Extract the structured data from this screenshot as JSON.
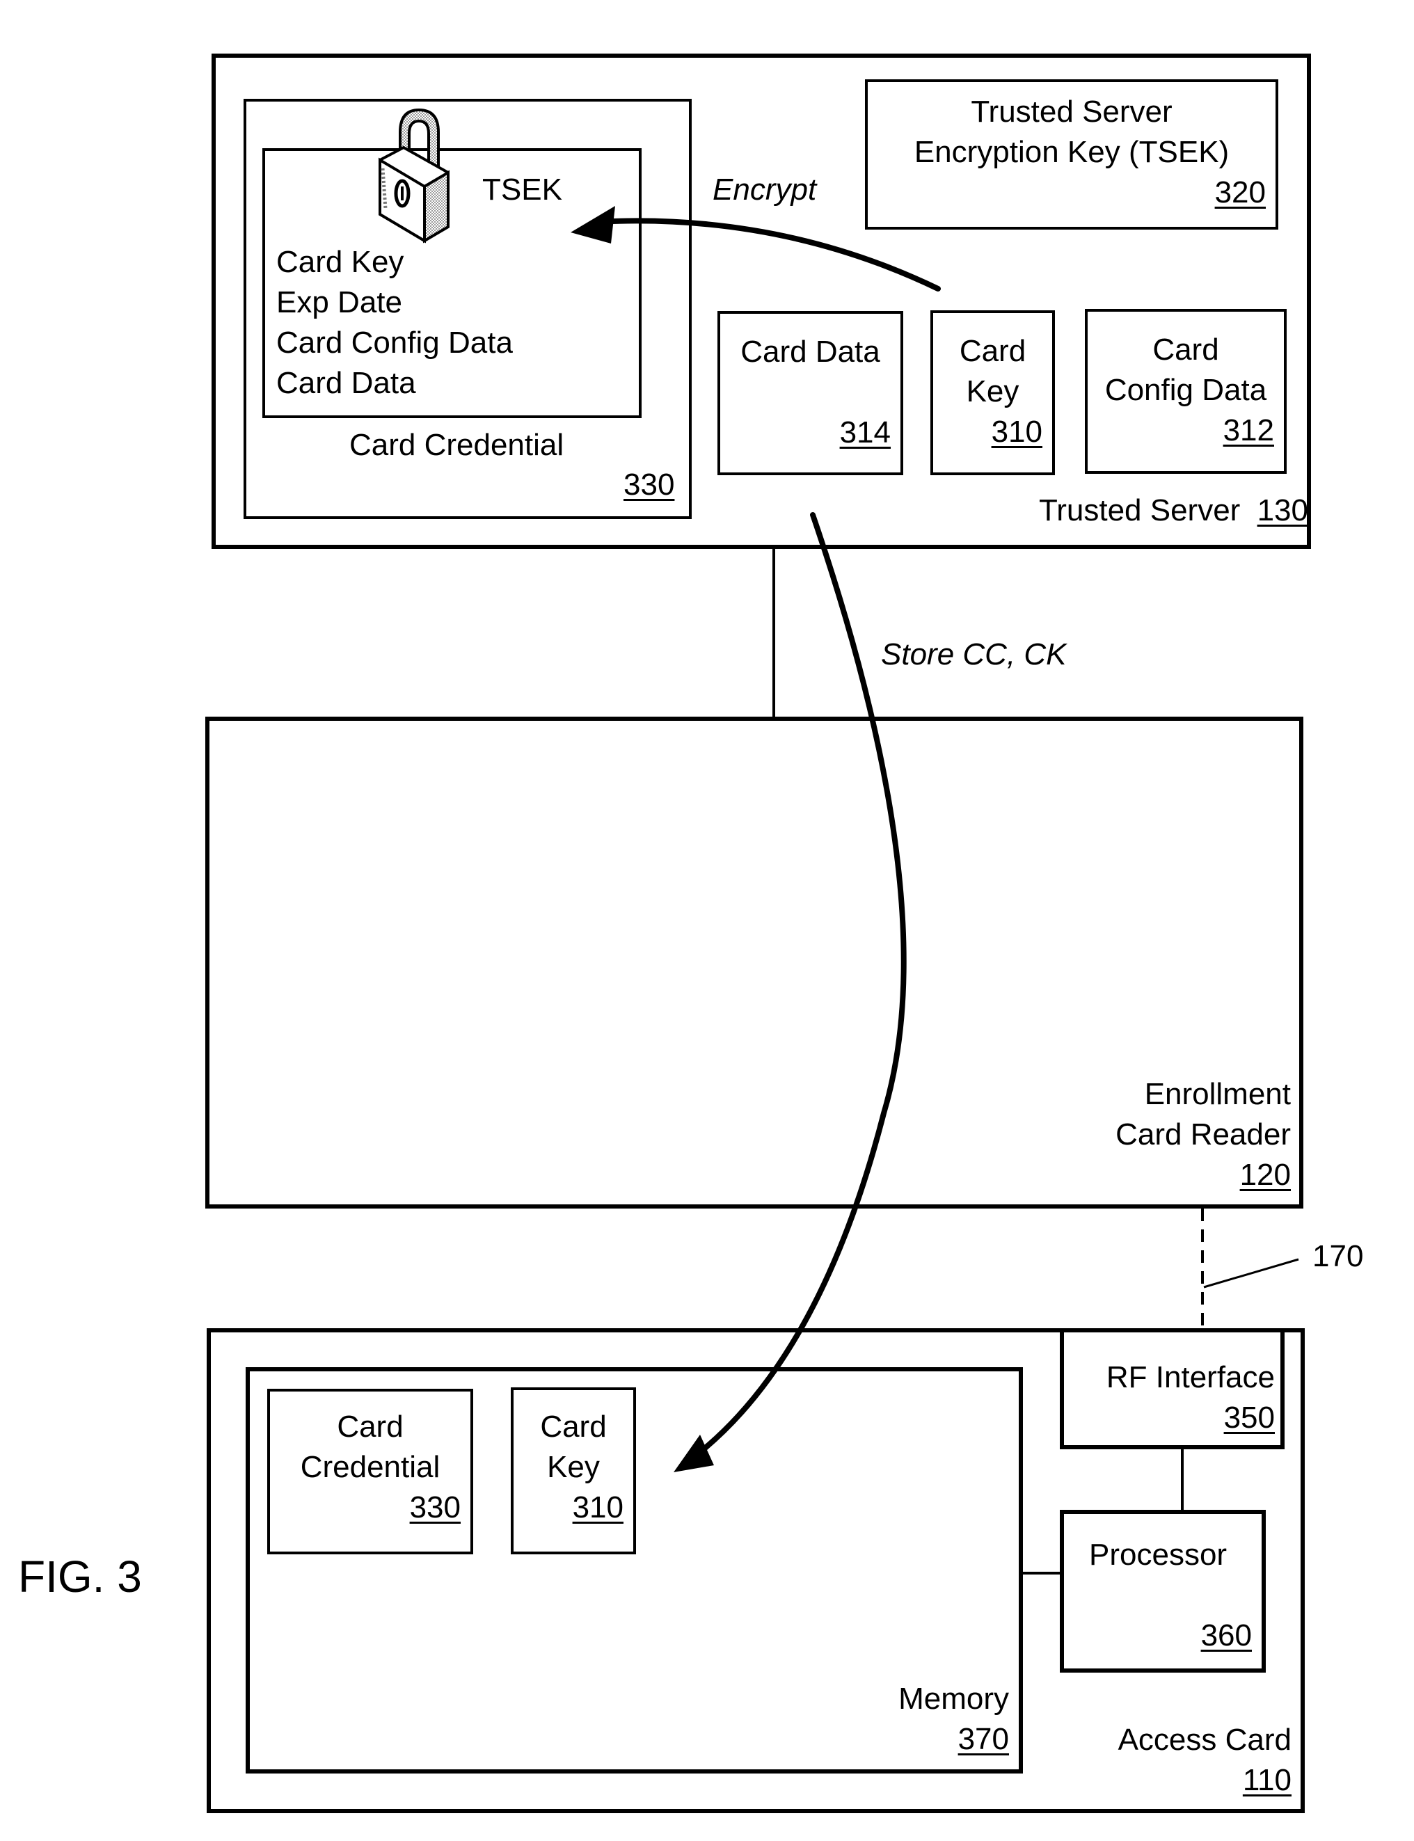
{
  "figure": {
    "label": "FIG. 3"
  },
  "trusted_server": {
    "name": "Trusted Server",
    "ref": "130",
    "tsek_box": {
      "line1": "Trusted Server",
      "line2": "Encryption Key (TSEK)",
      "ref": "320"
    },
    "card_data": {
      "label": "Card Data",
      "ref": "314"
    },
    "card_key": {
      "line1": "Card",
      "line2": "Key",
      "ref": "310"
    },
    "card_config": {
      "line1": "Card",
      "line2": "Config Data",
      "ref": "312"
    },
    "card_credential": {
      "label": "Card Credential",
      "ref": "330",
      "lock_label": "TSEK",
      "contents": [
        "Card Key",
        "Exp Date",
        "Card Config Data",
        "Card Data"
      ]
    },
    "encrypt_label": "Encrypt"
  },
  "store_label": "Store CC, CK",
  "enrollment_reader": {
    "line1": "Enrollment",
    "line2": "Card Reader",
    "ref": "120"
  },
  "link_ref": "170",
  "access_card": {
    "name": "Access Card",
    "ref": "110",
    "memory": {
      "name": "Memory",
      "ref": "370",
      "card_credential": {
        "line1": "Card",
        "line2": "Credential",
        "ref": "330"
      },
      "card_key": {
        "line1": "Card",
        "line2": "Key",
        "ref": "310"
      }
    },
    "rf_interface": {
      "name": "RF Interface",
      "ref": "350"
    },
    "processor": {
      "name": "Processor",
      "ref": "360"
    }
  }
}
